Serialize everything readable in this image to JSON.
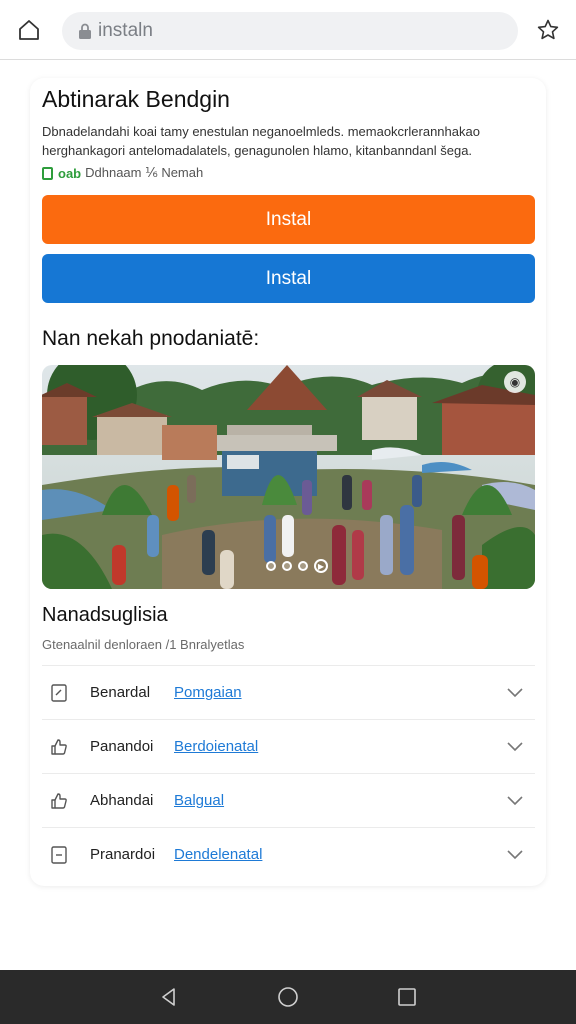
{
  "browser": {
    "url": "instaln",
    "icons": {
      "home": "home-icon",
      "lock": "lock-icon",
      "star": "star-icon"
    }
  },
  "app": {
    "title": "Abtinarak Bendgin",
    "description": "Dbnadelandahi koai tamy enestulan neganoelmleds. memaokcrlerannhakao herghankagori antelomadalatels, genagunolen hlamo, kitanbanndanl šega.",
    "rating_strong": "oab",
    "rating_text": "Ddhnaam ⅙ Nemah",
    "install_primary": "Instal",
    "install_secondary": "Instal",
    "colors": {
      "primary": "#fb6a0f",
      "secondary": "#1677d4",
      "link": "#1e7ad6",
      "rating": "#2e9d3c"
    }
  },
  "gallery": {
    "title": "Nan nekah pnodaniatē:",
    "image": "village-market-photo"
  },
  "details": {
    "title": "Nanadsuglisia",
    "meta": "Gtenaalnil denloraen /1 Bnralyetlas",
    "items": [
      {
        "icon": "document-icon",
        "label": "Benardal",
        "link": "Pomgaian"
      },
      {
        "icon": "thumbs-up-icon",
        "label": "Panandoi",
        "link": "Berdoienatal"
      },
      {
        "icon": "thumbs-up-icon",
        "label": "Abhandai",
        "link": "Balgual"
      },
      {
        "icon": "minus-box-icon",
        "label": "Pranardoi",
        "link": "Dendelenatal"
      }
    ]
  },
  "navigation": {
    "back": "back-icon",
    "home": "home-circle-icon",
    "recents": "recents-icon"
  }
}
